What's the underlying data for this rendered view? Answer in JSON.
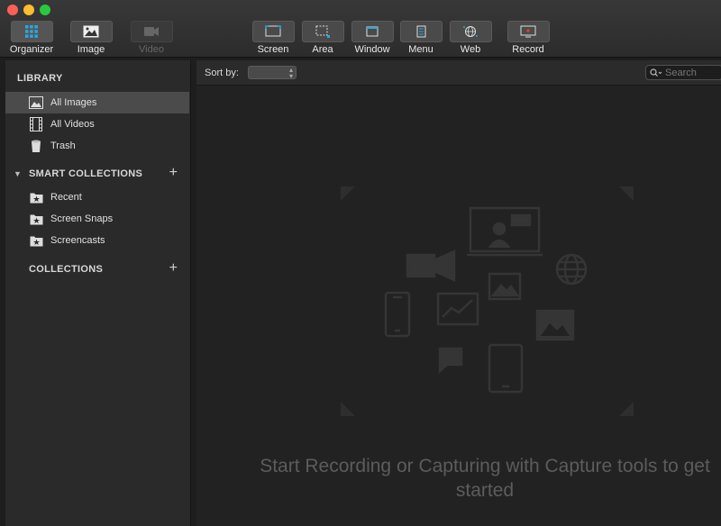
{
  "window": {
    "buttons": [
      "close",
      "minimize",
      "maximize"
    ]
  },
  "toolbar": {
    "tabs": [
      {
        "label": "Organizer",
        "icon": "grid-icon",
        "selected": true
      },
      {
        "label": "Image",
        "icon": "image-icon"
      },
      {
        "label": "Video",
        "icon": "video-camera-icon",
        "disabled": true
      }
    ],
    "capture": [
      {
        "label": "Screen",
        "icon": "screen-icon"
      },
      {
        "label": "Area",
        "icon": "area-icon"
      },
      {
        "label": "Window",
        "icon": "window-icon"
      },
      {
        "label": "Menu",
        "icon": "menu-icon"
      },
      {
        "label": "Web",
        "icon": "globe-icon"
      },
      {
        "label": "Record",
        "icon": "record-icon"
      }
    ]
  },
  "sidebar": {
    "library": {
      "heading": "LIBRARY",
      "items": [
        {
          "label": "All Images",
          "icon": "image-icon",
          "selected": true
        },
        {
          "label": "All Videos",
          "icon": "film-icon"
        },
        {
          "label": "Trash",
          "icon": "trash-icon"
        }
      ]
    },
    "smart_collections": {
      "heading": "SMART COLLECTIONS",
      "add": "+",
      "items": [
        {
          "label": "Recent",
          "icon": "star-folder-icon"
        },
        {
          "label": "Screen Snaps",
          "icon": "star-folder-icon"
        },
        {
          "label": "Screencasts",
          "icon": "star-folder-icon"
        }
      ]
    },
    "collections": {
      "heading": "COLLECTIONS",
      "add": "+"
    }
  },
  "main": {
    "sort_label": "Sort by:",
    "sort_value": "",
    "search_placeholder": "Search",
    "empty_message": "Start Recording or Capturing with Capture tools to get started"
  },
  "colors": {
    "accent_blue": "#2aa9e0",
    "record_red": "#e03a3a"
  }
}
